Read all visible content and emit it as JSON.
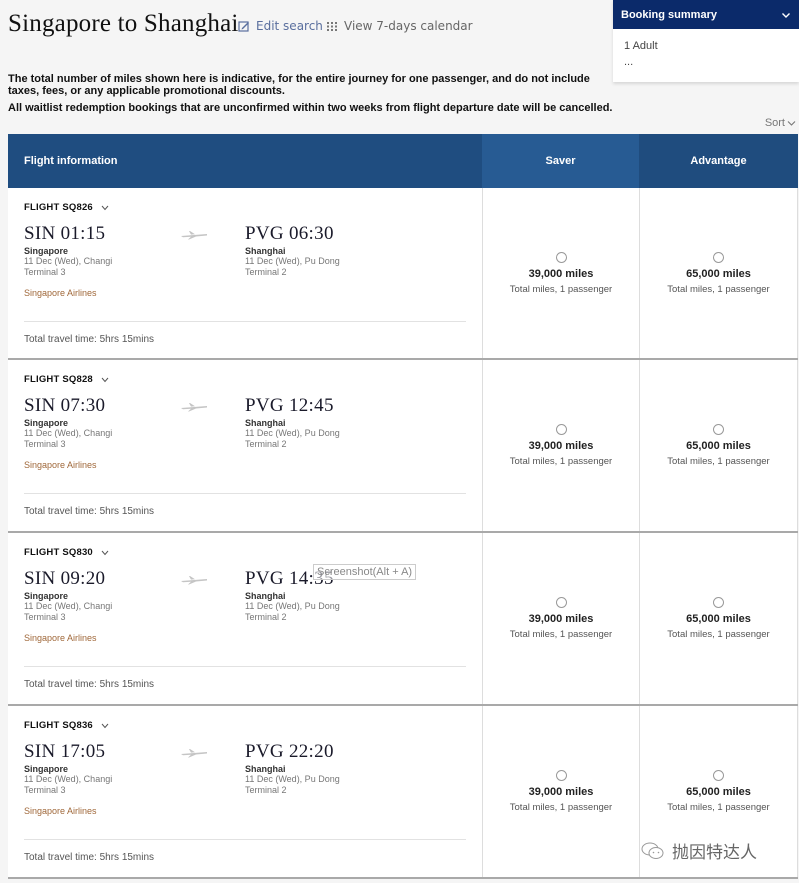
{
  "header": {
    "title": "Singapore to Shanghai",
    "edit_search": "Edit search",
    "view_calendar": "View 7-days calendar"
  },
  "booking_summary": {
    "title": "Booking summary",
    "passengers": "1 Adult",
    "more": "..."
  },
  "notices": [
    "The total number of miles shown here is indicative, for the entire journey for one passenger, and do not include taxes, fees, or any applicable promotional discounts.",
    "All waitlist redemption bookings that are unconfirmed within two weeks from flight departure date will be cancelled."
  ],
  "sort_label": "Sort",
  "table": {
    "col_flight_info": "Flight information",
    "col_saver": "Saver",
    "col_advantage": "Advantage"
  },
  "flights": [
    {
      "flight_no": "FLIGHT SQ826",
      "dep_time": "SIN 01:15",
      "dep_city": "Singapore",
      "dep_date": "11 Dec (Wed), Changi",
      "dep_terminal": "Terminal 3",
      "arr_time": "PVG 06:30",
      "arr_city": "Shanghai",
      "arr_date": "11 Dec (Wed), Pu Dong",
      "arr_terminal": "Terminal 2",
      "airline": "Singapore Airlines",
      "travel_time": "Total travel time: 5hrs 15mins",
      "saver_miles": "39,000 miles",
      "saver_sub": "Total miles, 1 passenger",
      "adv_miles": "65,000 miles",
      "adv_sub": "Total miles, 1 passenger"
    },
    {
      "flight_no": "FLIGHT SQ828",
      "dep_time": "SIN 07:30",
      "dep_city": "Singapore",
      "dep_date": "11 Dec (Wed), Changi",
      "dep_terminal": "Terminal 3",
      "arr_time": "PVG 12:45",
      "arr_city": "Shanghai",
      "arr_date": "11 Dec (Wed), Pu Dong",
      "arr_terminal": "Terminal 2",
      "airline": "Singapore Airlines",
      "travel_time": "Total travel time: 5hrs 15mins",
      "saver_miles": "39,000 miles",
      "saver_sub": "Total miles, 1 passenger",
      "adv_miles": "65,000 miles",
      "adv_sub": "Total miles, 1 passenger"
    },
    {
      "flight_no": "FLIGHT SQ830",
      "dep_time": "SIN 09:20",
      "dep_city": "Singapore",
      "dep_date": "11 Dec (Wed), Changi",
      "dep_terminal": "Terminal 3",
      "arr_time": "PVG 14:35",
      "arr_city": "Shanghai",
      "arr_date": "11 Dec (Wed), Pu Dong",
      "arr_terminal": "Terminal 2",
      "airline": "Singapore Airlines",
      "travel_time": "Total travel time: 5hrs 15mins",
      "saver_miles": "39,000 miles",
      "saver_sub": "Total miles, 1 passenger",
      "adv_miles": "65,000 miles",
      "adv_sub": "Total miles, 1 passenger"
    },
    {
      "flight_no": "FLIGHT SQ836",
      "dep_time": "SIN 17:05",
      "dep_city": "Singapore",
      "dep_date": "11 Dec (Wed), Changi",
      "dep_terminal": "Terminal 3",
      "arr_time": "PVG 22:20",
      "arr_city": "Shanghai",
      "arr_date": "11 Dec (Wed), Pu Dong",
      "arr_terminal": "Terminal 2",
      "airline": "Singapore Airlines",
      "travel_time": "Total travel time: 5hrs 15mins",
      "saver_miles": "39,000 miles",
      "saver_sub": "Total miles, 1 passenger",
      "adv_miles": "65,000 miles",
      "adv_sub": "Total miles, 1 passenger"
    }
  ],
  "tooltip": "Screenshot(Alt + A)",
  "watermark": "抛因特达人",
  "colors": {
    "summary_header": "#0b2a6a",
    "table_header": "#1f4d80",
    "saver_header": "#275b93",
    "advantage_header": "#1f4c7e",
    "airline_text": "#a0683a",
    "edit_link": "#5a6f9e"
  }
}
